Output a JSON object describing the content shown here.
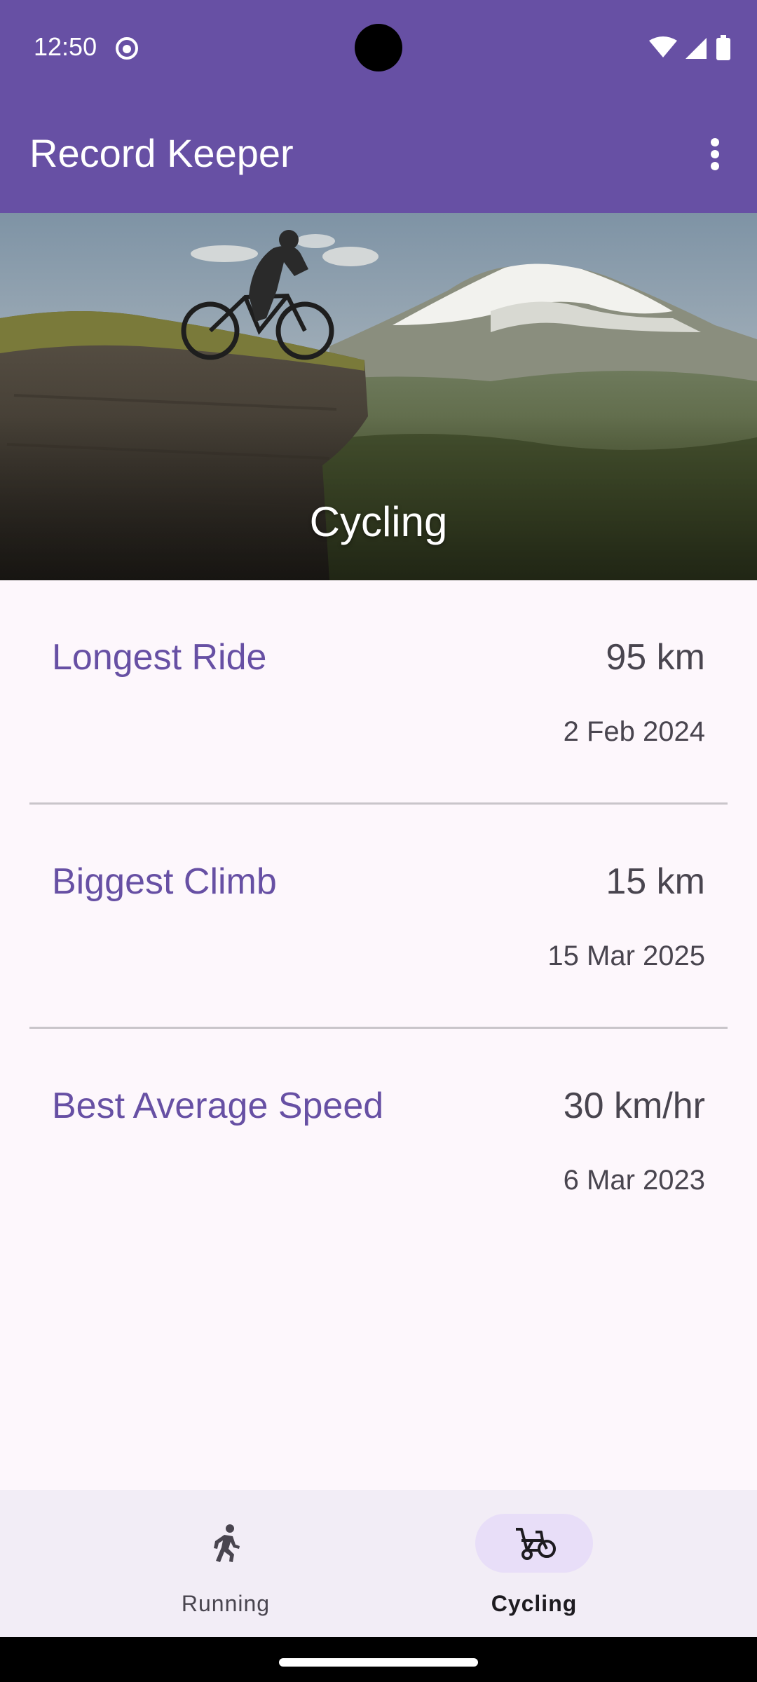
{
  "status_bar": {
    "time": "12:50",
    "icons": [
      "app-notification-icon",
      "wifi-icon",
      "signal-icon",
      "battery-icon"
    ]
  },
  "app_bar": {
    "title": "Record Keeper",
    "menu_icon": "more-vert-icon"
  },
  "hero": {
    "label": "Cycling",
    "image": "cyclist-on-cliff-mountain-photo"
  },
  "records": [
    {
      "name": "Longest Ride",
      "value": "95 km",
      "date": "2 Feb 2024"
    },
    {
      "name": "Biggest Climb",
      "value": "15 km",
      "date": "15 Mar 2025"
    },
    {
      "name": "Best Average Speed",
      "value": "30 km/hr",
      "date": "6 Mar 2023"
    }
  ],
  "bottom_nav": {
    "items": [
      {
        "label": "Running",
        "icon": "running-icon",
        "selected": false
      },
      {
        "label": "Cycling",
        "icon": "cycling-icon",
        "selected": true
      }
    ]
  },
  "colors": {
    "primary": "#6750A4",
    "surface": "#FDF7FC",
    "nav_background": "#F2EDF6",
    "nav_indicator": "#E8DEF8"
  }
}
